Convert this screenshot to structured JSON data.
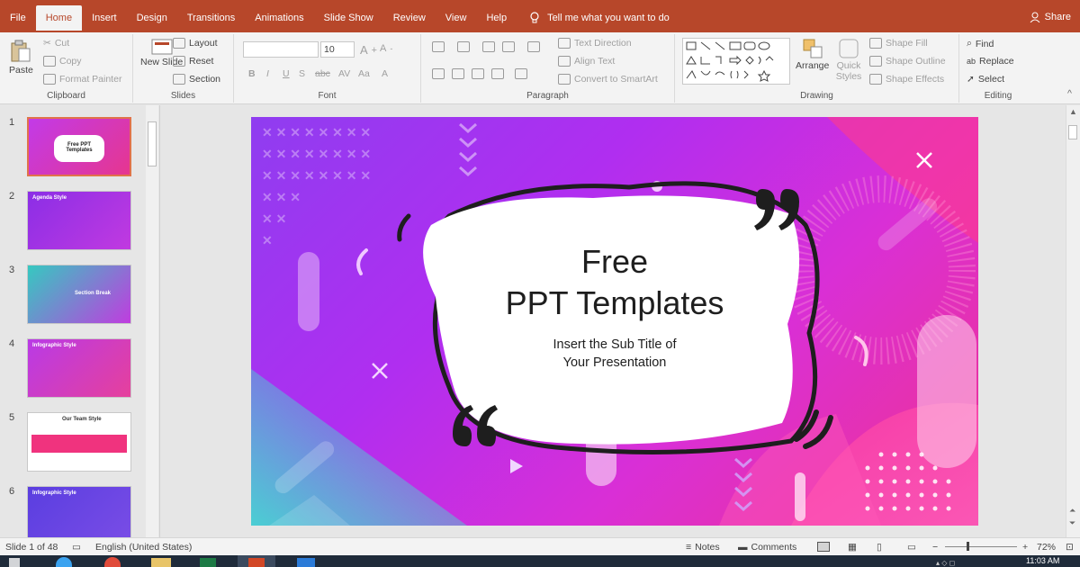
{
  "tabs": [
    "File",
    "Home",
    "Insert",
    "Design",
    "Transitions",
    "Animations",
    "Slide Show",
    "Review",
    "View",
    "Help"
  ],
  "tell_me": "Tell me what you want to do",
  "share": "Share",
  "ribbon": {
    "clipboard": {
      "paste": "Paste",
      "cut": "Cut",
      "copy": "Copy",
      "format_painter": "Format Painter",
      "label": "Clipboard"
    },
    "slides": {
      "new_slide": "New Slide",
      "layout": "Layout",
      "reset": "Reset",
      "section": "Section",
      "label": "Slides"
    },
    "font": {
      "size": "10",
      "label": "Font"
    },
    "paragraph": {
      "text_direction": "Text Direction",
      "align_text": "Align Text",
      "convert": "Convert to SmartArt",
      "label": "Paragraph"
    },
    "drawing": {
      "arrange": "Arrange",
      "quick_styles": "Quick Styles",
      "shape_fill": "Shape Fill",
      "shape_outline": "Shape Outline",
      "shape_effects": "Shape Effects",
      "label": "Drawing"
    },
    "editing": {
      "find": "Find",
      "replace": "Replace",
      "select": "Select",
      "label": "Editing"
    }
  },
  "thumbnails": [
    {
      "num": "1",
      "title": "Free PPT Templates",
      "colors": [
        "#c23ae8",
        "#e6368f"
      ]
    },
    {
      "num": "2",
      "title": "Agenda Style",
      "colors": [
        "#8b2ee6",
        "#c13ae0"
      ]
    },
    {
      "num": "3",
      "title": "Section Break",
      "colors": [
        "#35c9c0",
        "#c03cdf"
      ]
    },
    {
      "num": "4",
      "title": "Infographic Style",
      "colors": [
        "#b93ae6",
        "#e6409c"
      ]
    },
    {
      "num": "5",
      "title": "Our Team Style",
      "colors": [
        "#ffffff",
        "#ffffff"
      ]
    },
    {
      "num": "6",
      "title": "Infographic Style",
      "colors": [
        "#5a3ee0",
        "#7a4de6"
      ]
    }
  ],
  "slide": {
    "title_line1": "Free",
    "title_line2": "PPT Templates",
    "subtitle_line1": "Insert the Sub Title of",
    "subtitle_line2": "Your Presentation"
  },
  "status": {
    "slide_info": "Slide 1 of 48",
    "language": "English (United States)",
    "notes": "Notes",
    "comments": "Comments",
    "zoom": "72%"
  },
  "taskbar": {
    "clock": "11:03 AM"
  }
}
